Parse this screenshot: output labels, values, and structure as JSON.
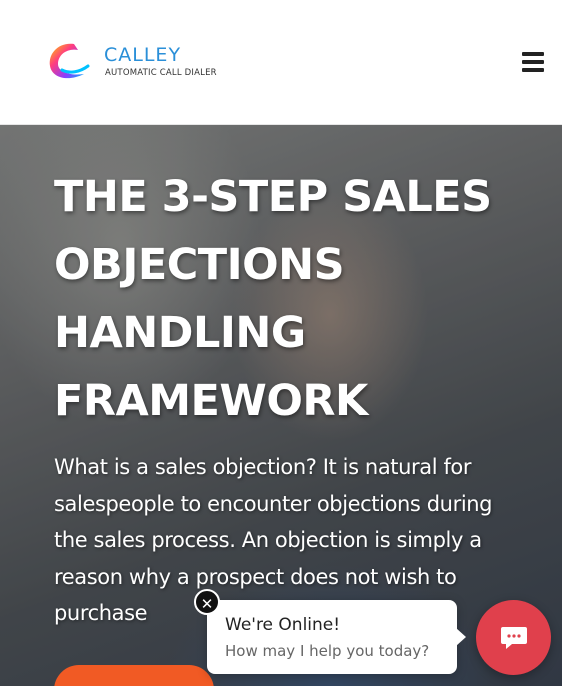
{
  "header": {
    "logo": {
      "name": "CALLEY",
      "tagline": "AUTOMATIC CALL DIALER"
    },
    "menu_icon": "hamburger-menu-icon"
  },
  "hero": {
    "title_lines": [
      "THE 3-STEP SALES",
      "OBJECTIONS",
      "HANDLING",
      "FRAMEWORK"
    ],
    "description": "What is a sales objection? It is natural for salespeople to encounter objections during the sales process. An objection is simply a reason why a prospect does not wish to purchase",
    "cta_color": "#f15a24"
  },
  "chat": {
    "title": "We're Online!",
    "subtitle": "How may I help you today?",
    "close_icon": "close-icon",
    "launcher_icon": "chat-bubble-icon",
    "accent": "#e0404c"
  }
}
